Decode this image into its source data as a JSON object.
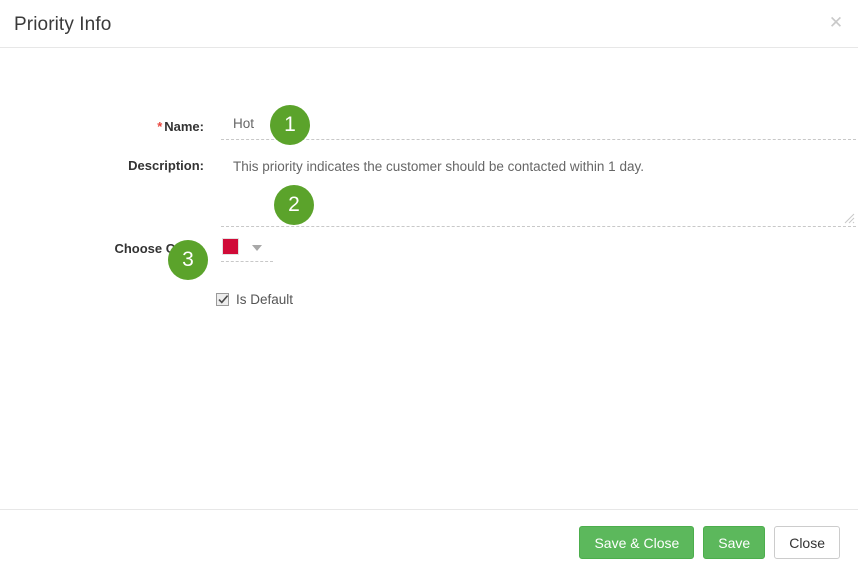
{
  "dialog": {
    "title": "Priority Info",
    "close_icon": "close-x-icon"
  },
  "form": {
    "name": {
      "label": "Name:",
      "required_marker": "*",
      "value": "Hot"
    },
    "description": {
      "label": "Description:",
      "value": "This priority indicates the customer should be contacted within 1 day."
    },
    "choose_color": {
      "label": "Choose Color:",
      "value": "#d00b38",
      "caret_icon": "chevron-down-icon"
    },
    "is_default": {
      "label": "Is Default",
      "checked": true
    }
  },
  "annotations": [
    {
      "number": "1"
    },
    {
      "number": "2"
    },
    {
      "number": "3"
    }
  ],
  "footer": {
    "save_and_close_label": "Save & Close",
    "save_label": "Save",
    "close_label": "Close"
  },
  "colors": {
    "accent_green": "#5cb85c",
    "badge_green": "#5ba32b",
    "required_red": "#e8433c",
    "swatch_red": "#d00b38"
  }
}
